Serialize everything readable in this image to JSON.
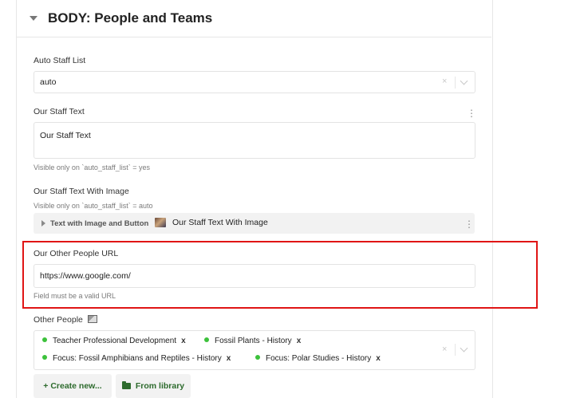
{
  "section": {
    "title": "BODY: People and Teams"
  },
  "auto_staff_list": {
    "label": "Auto Staff List",
    "value": "auto",
    "clear": "×"
  },
  "our_staff_text": {
    "label": "Our Staff Text",
    "menu": "⋮",
    "value": "Our Staff Text",
    "hint": "Visible only on `auto_staff_list` = yes"
  },
  "our_staff_text_with_image": {
    "label": "Our Staff Text With Image",
    "hint": "Visible only on `auto_staff_list` = auto",
    "block_type": "Text with Image and Button",
    "block_title": "Our Staff Text With Image",
    "menu": "⋮"
  },
  "our_other_people_url": {
    "label": "Our Other People URL",
    "value": "https://www.google.com/",
    "hint": "Field must be a valid URL"
  },
  "other_people": {
    "label": "Other People",
    "clear": "×",
    "tags": [
      {
        "text": "Teacher Professional Development",
        "remove": "x"
      },
      {
        "text": "Fossil Plants - History",
        "remove": "x"
      },
      {
        "text": "Focus: Fossil Amphibians and Reptiles - History",
        "remove": "x"
      },
      {
        "text": "Focus: Polar Studies - History",
        "remove": "x"
      }
    ]
  },
  "actions": {
    "create_new": "+ Create new...",
    "from_library": "From library"
  },
  "colors": {
    "highlight": "#e01515",
    "tag_dot": "#3cc13b",
    "action_text": "#2d6b2d"
  }
}
